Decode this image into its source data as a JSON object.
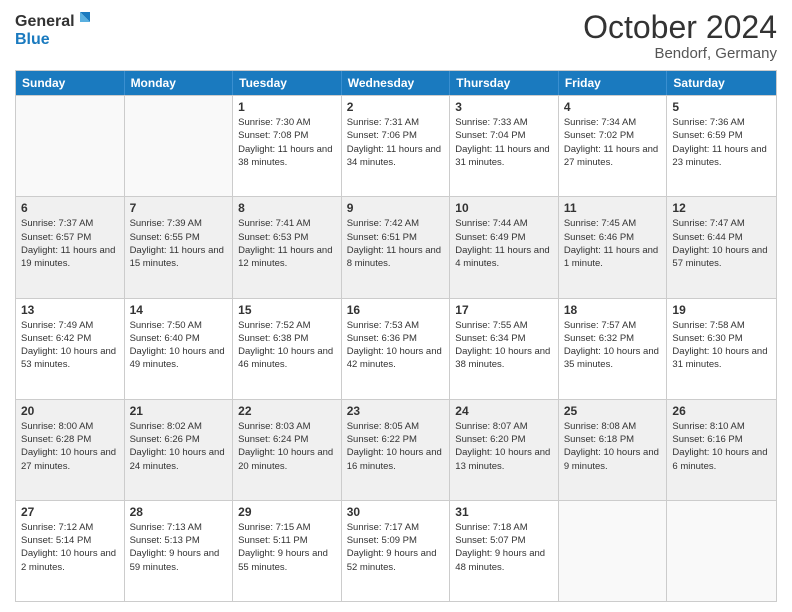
{
  "header": {
    "logo_line1": "General",
    "logo_line2": "Blue",
    "month": "October 2024",
    "location": "Bendorf, Germany"
  },
  "days_of_week": [
    "Sunday",
    "Monday",
    "Tuesday",
    "Wednesday",
    "Thursday",
    "Friday",
    "Saturday"
  ],
  "rows": [
    [
      {
        "day": "",
        "sunrise": "",
        "sunset": "",
        "daylight": "",
        "empty": true
      },
      {
        "day": "",
        "sunrise": "",
        "sunset": "",
        "daylight": "",
        "empty": true
      },
      {
        "day": "1",
        "sunrise": "Sunrise: 7:30 AM",
        "sunset": "Sunset: 7:08 PM",
        "daylight": "Daylight: 11 hours and 38 minutes."
      },
      {
        "day": "2",
        "sunrise": "Sunrise: 7:31 AM",
        "sunset": "Sunset: 7:06 PM",
        "daylight": "Daylight: 11 hours and 34 minutes."
      },
      {
        "day": "3",
        "sunrise": "Sunrise: 7:33 AM",
        "sunset": "Sunset: 7:04 PM",
        "daylight": "Daylight: 11 hours and 31 minutes."
      },
      {
        "day": "4",
        "sunrise": "Sunrise: 7:34 AM",
        "sunset": "Sunset: 7:02 PM",
        "daylight": "Daylight: 11 hours and 27 minutes."
      },
      {
        "day": "5",
        "sunrise": "Sunrise: 7:36 AM",
        "sunset": "Sunset: 6:59 PM",
        "daylight": "Daylight: 11 hours and 23 minutes."
      }
    ],
    [
      {
        "day": "6",
        "sunrise": "Sunrise: 7:37 AM",
        "sunset": "Sunset: 6:57 PM",
        "daylight": "Daylight: 11 hours and 19 minutes."
      },
      {
        "day": "7",
        "sunrise": "Sunrise: 7:39 AM",
        "sunset": "Sunset: 6:55 PM",
        "daylight": "Daylight: 11 hours and 15 minutes."
      },
      {
        "day": "8",
        "sunrise": "Sunrise: 7:41 AM",
        "sunset": "Sunset: 6:53 PM",
        "daylight": "Daylight: 11 hours and 12 minutes."
      },
      {
        "day": "9",
        "sunrise": "Sunrise: 7:42 AM",
        "sunset": "Sunset: 6:51 PM",
        "daylight": "Daylight: 11 hours and 8 minutes."
      },
      {
        "day": "10",
        "sunrise": "Sunrise: 7:44 AM",
        "sunset": "Sunset: 6:49 PM",
        "daylight": "Daylight: 11 hours and 4 minutes."
      },
      {
        "day": "11",
        "sunrise": "Sunrise: 7:45 AM",
        "sunset": "Sunset: 6:46 PM",
        "daylight": "Daylight: 11 hours and 1 minute."
      },
      {
        "day": "12",
        "sunrise": "Sunrise: 7:47 AM",
        "sunset": "Sunset: 6:44 PM",
        "daylight": "Daylight: 10 hours and 57 minutes."
      }
    ],
    [
      {
        "day": "13",
        "sunrise": "Sunrise: 7:49 AM",
        "sunset": "Sunset: 6:42 PM",
        "daylight": "Daylight: 10 hours and 53 minutes."
      },
      {
        "day": "14",
        "sunrise": "Sunrise: 7:50 AM",
        "sunset": "Sunset: 6:40 PM",
        "daylight": "Daylight: 10 hours and 49 minutes."
      },
      {
        "day": "15",
        "sunrise": "Sunrise: 7:52 AM",
        "sunset": "Sunset: 6:38 PM",
        "daylight": "Daylight: 10 hours and 46 minutes."
      },
      {
        "day": "16",
        "sunrise": "Sunrise: 7:53 AM",
        "sunset": "Sunset: 6:36 PM",
        "daylight": "Daylight: 10 hours and 42 minutes."
      },
      {
        "day": "17",
        "sunrise": "Sunrise: 7:55 AM",
        "sunset": "Sunset: 6:34 PM",
        "daylight": "Daylight: 10 hours and 38 minutes."
      },
      {
        "day": "18",
        "sunrise": "Sunrise: 7:57 AM",
        "sunset": "Sunset: 6:32 PM",
        "daylight": "Daylight: 10 hours and 35 minutes."
      },
      {
        "day": "19",
        "sunrise": "Sunrise: 7:58 AM",
        "sunset": "Sunset: 6:30 PM",
        "daylight": "Daylight: 10 hours and 31 minutes."
      }
    ],
    [
      {
        "day": "20",
        "sunrise": "Sunrise: 8:00 AM",
        "sunset": "Sunset: 6:28 PM",
        "daylight": "Daylight: 10 hours and 27 minutes."
      },
      {
        "day": "21",
        "sunrise": "Sunrise: 8:02 AM",
        "sunset": "Sunset: 6:26 PM",
        "daylight": "Daylight: 10 hours and 24 minutes."
      },
      {
        "day": "22",
        "sunrise": "Sunrise: 8:03 AM",
        "sunset": "Sunset: 6:24 PM",
        "daylight": "Daylight: 10 hours and 20 minutes."
      },
      {
        "day": "23",
        "sunrise": "Sunrise: 8:05 AM",
        "sunset": "Sunset: 6:22 PM",
        "daylight": "Daylight: 10 hours and 16 minutes."
      },
      {
        "day": "24",
        "sunrise": "Sunrise: 8:07 AM",
        "sunset": "Sunset: 6:20 PM",
        "daylight": "Daylight: 10 hours and 13 minutes."
      },
      {
        "day": "25",
        "sunrise": "Sunrise: 8:08 AM",
        "sunset": "Sunset: 6:18 PM",
        "daylight": "Daylight: 10 hours and 9 minutes."
      },
      {
        "day": "26",
        "sunrise": "Sunrise: 8:10 AM",
        "sunset": "Sunset: 6:16 PM",
        "daylight": "Daylight: 10 hours and 6 minutes."
      }
    ],
    [
      {
        "day": "27",
        "sunrise": "Sunrise: 7:12 AM",
        "sunset": "Sunset: 5:14 PM",
        "daylight": "Daylight: 10 hours and 2 minutes."
      },
      {
        "day": "28",
        "sunrise": "Sunrise: 7:13 AM",
        "sunset": "Sunset: 5:13 PM",
        "daylight": "Daylight: 9 hours and 59 minutes."
      },
      {
        "day": "29",
        "sunrise": "Sunrise: 7:15 AM",
        "sunset": "Sunset: 5:11 PM",
        "daylight": "Daylight: 9 hours and 55 minutes."
      },
      {
        "day": "30",
        "sunrise": "Sunrise: 7:17 AM",
        "sunset": "Sunset: 5:09 PM",
        "daylight": "Daylight: 9 hours and 52 minutes."
      },
      {
        "day": "31",
        "sunrise": "Sunrise: 7:18 AM",
        "sunset": "Sunset: 5:07 PM",
        "daylight": "Daylight: 9 hours and 48 minutes."
      },
      {
        "day": "",
        "sunrise": "",
        "sunset": "",
        "daylight": "",
        "empty": true
      },
      {
        "day": "",
        "sunrise": "",
        "sunset": "",
        "daylight": "",
        "empty": true
      }
    ]
  ]
}
